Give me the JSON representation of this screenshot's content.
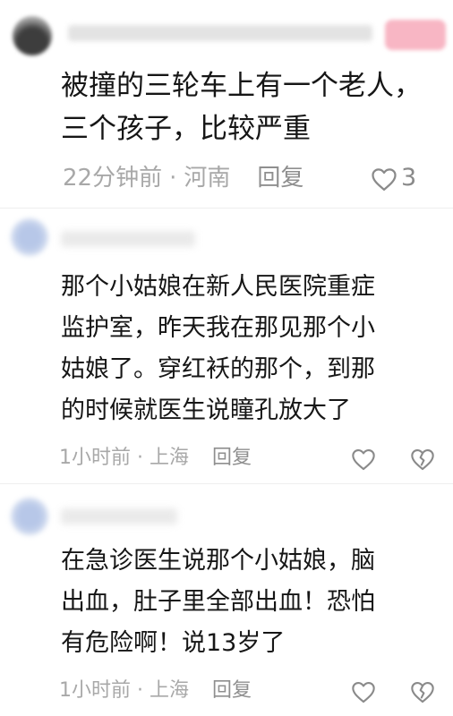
{
  "comments": [
    {
      "text": "被撞的三轮车上有一个老人，\n三个孩子，比较严重",
      "time": "22分钟前",
      "location": "河南",
      "separator": "·",
      "reply_label": "回复",
      "like_count": "3"
    },
    {
      "text": "那个小姑娘在新人民医院重症\n监护室，昨天我在那见那个小\n姑娘了。穿红袄的那个，到那\n的时候就医生说瞳孔放大了",
      "time": "1小时前",
      "location": "上海",
      "separator": "·",
      "reply_label": "回复"
    },
    {
      "text": "在急诊医生说那个小姑娘，脑\n出血，肚子里全部出血！恐怕\n有危险啊！说13岁了",
      "time": "1小时前",
      "location": "上海",
      "separator": "·",
      "reply_label": "回复"
    }
  ],
  "colors": {
    "text": "#161616",
    "meta": "#a8a8a8",
    "badge": "#f8b6c4",
    "avatar_blur": "#c9d6ee"
  },
  "icons": {
    "like": "heart-outline-icon",
    "dislike": "broken-heart-icon"
  }
}
